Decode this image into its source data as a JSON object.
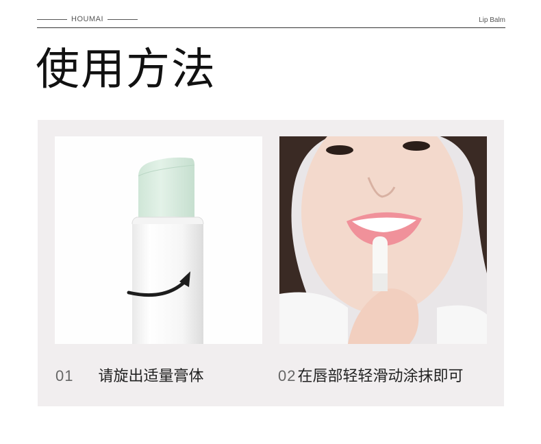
{
  "header": {
    "brand": "HOUMAI",
    "product": "Lip Balm"
  },
  "title": "使用方法",
  "steps": [
    {
      "number": "01",
      "text": "请旋出适量膏体"
    },
    {
      "number": "02",
      "text": "在唇部轻轻滑动涂抹即可"
    }
  ],
  "colors": {
    "panel": "#f1eeef",
    "balm": "#dbeee2",
    "lip": "#f0919a"
  }
}
